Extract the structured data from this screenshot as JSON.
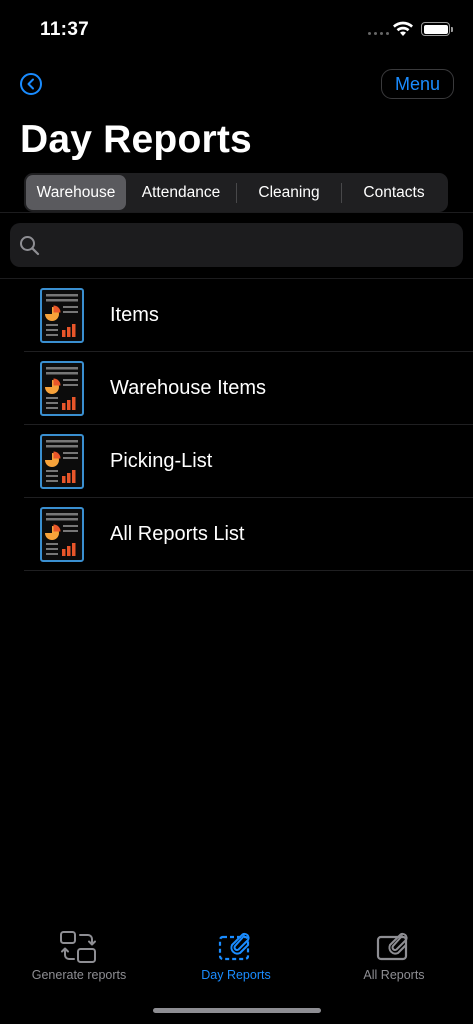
{
  "status": {
    "time": "11:37"
  },
  "nav": {
    "back_icon": "chevron-left-circle-icon",
    "menu_label": "Menu",
    "accent": "#1a8cff"
  },
  "title": "Day Reports",
  "segments": [
    {
      "label": "Warehouse",
      "selected": true
    },
    {
      "label": "Attendance",
      "selected": false
    },
    {
      "label": "Cleaning",
      "selected": false
    },
    {
      "label": "Contacts",
      "selected": false
    }
  ],
  "search": {
    "placeholder": "",
    "value": ""
  },
  "reports": [
    {
      "label": "Items",
      "icon": "report-document-icon"
    },
    {
      "label": "Warehouse Items",
      "icon": "report-document-icon"
    },
    {
      "label": "Picking-List",
      "icon": "report-document-icon"
    },
    {
      "label": "All Reports List",
      "icon": "report-document-icon"
    }
  ],
  "tabs": [
    {
      "label": "Generate reports",
      "icon": "generate-reports-icon",
      "active": false
    },
    {
      "label": "Day Reports",
      "icon": "day-reports-icon",
      "active": true
    },
    {
      "label": "All Reports",
      "icon": "all-reports-icon",
      "active": false
    }
  ],
  "colors": {
    "background": "#000000",
    "accent": "#1a8cff",
    "icon_orange": "#f07a2a",
    "icon_border": "#3a8fd0",
    "secondary": "#8e8e93"
  }
}
